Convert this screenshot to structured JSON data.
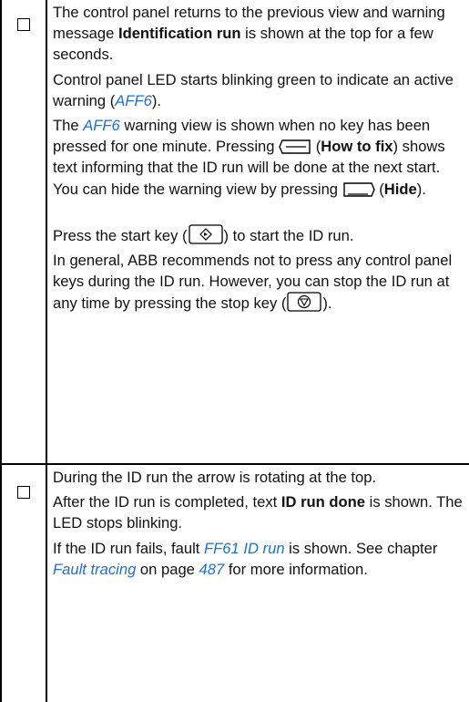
{
  "step1": {
    "para1": {
      "t1": "The control panel returns to the previous view and warning message ",
      "b1": "Identification run",
      "t2": " is shown at the top for a few seconds."
    },
    "para2": {
      "t1": "Control panel LED starts blinking green to indicate an active warning (",
      "link1": "AFF6",
      "t2": ")."
    },
    "para3": {
      "t1": "The ",
      "link1": "AFF6",
      "t2": " warning view is shown when no key has been pressed for one minute. Pressing ",
      "t3": " (",
      "b1": "How to fix",
      "t4": ") shows text informing that the ID run will be done at the next start. You can hide the warning view by pressing ",
      "t5": " (",
      "b2": "Hide",
      "t6": ")."
    },
    "para4": {
      "t1": "Press the start key (",
      "t2": ") to start the ID run."
    },
    "para5": {
      "t1": "In general, ABB recommends not to press any control panel keys during the ID run. However, you can stop the ID run at any time by pressing the stop key (",
      "t2": ")."
    }
  },
  "step2": {
    "para1": "During the ID run the arrow is rotating at the top.",
    "para2": {
      "t1": "After the ID run is completed, text ",
      "b1": "ID run done",
      "t2": " is shown. The LED stops blinking."
    },
    "para3": {
      "t1": "If the ID run fails, fault ",
      "link1": "FF61 ID run",
      "t2": " is shown. See chapter ",
      "link2": "Fault tracing",
      "t3": " on page ",
      "link3": "487",
      "t4": " for more information."
    }
  },
  "icons": {
    "checkbox": "checkbox-icon",
    "left_softkey": "left-softkey-icon",
    "right_softkey": "right-softkey-icon",
    "start_key": "start-key-icon",
    "stop_key": "stop-key-icon"
  },
  "colors": {
    "link": "#1f6fd1",
    "text": "#111111",
    "border": "#000000"
  }
}
